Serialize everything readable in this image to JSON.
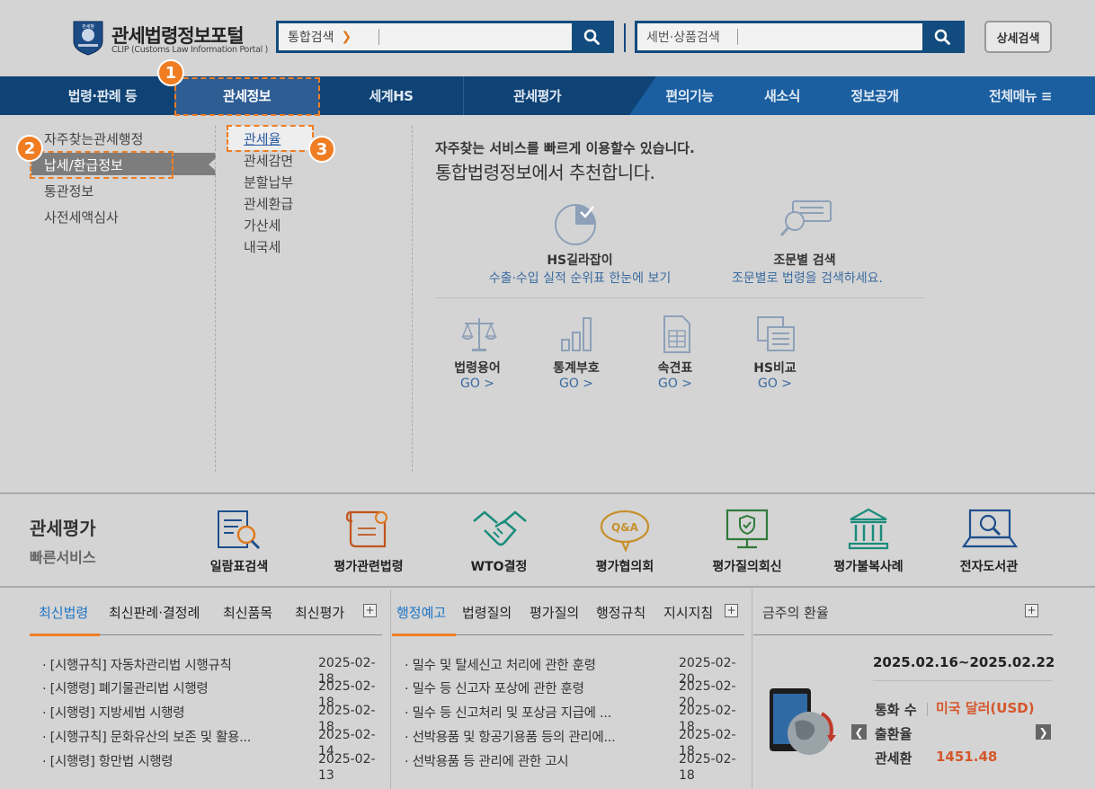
{
  "header": {
    "logo_title": "관세법령정보포털",
    "logo_subtitle": "CLIP (Customs Law Information Portal )",
    "emblem_text": "관세청",
    "search": {
      "category": "통합검색",
      "placeholder": ""
    },
    "hs_search": {
      "placeholder": "세번·상품검색"
    },
    "advanced_label": "상세검색"
  },
  "nav": {
    "items": [
      "법령·판례 등",
      "관세정보",
      "세계HS",
      "관세평가",
      "편의기능",
      "새소식",
      "정보공개"
    ],
    "all_menu": "전체메뉴 ≡"
  },
  "badges": [
    "1",
    "2",
    "3"
  ],
  "mega_menu": {
    "left": [
      "자주찾는관세행정",
      "납세/환급정보",
      "통관정보",
      "사전세액심사"
    ],
    "sub": [
      "관세율",
      "관세감면",
      "분할납부",
      "관세환급",
      "가산세",
      "내국세"
    ],
    "recommend_line1": "자주찾는 서비스를 빠르게 이용할수 있습니다.",
    "recommend_line2": "통합법령정보에서 추천합니다.",
    "services": [
      {
        "title": "HS길라잡이",
        "desc": "수출·수입 실적 순위표 한눈에 보기"
      },
      {
        "title": "조문별 검색",
        "desc": "조문별로 법령을 검색하세요."
      }
    ],
    "tools": [
      {
        "title": "법령용어",
        "go": "GO >"
      },
      {
        "title": "통계부호",
        "go": "GO >"
      },
      {
        "title": "속견표",
        "go": "GO >"
      },
      {
        "title": "HS비교",
        "go": "GO >"
      }
    ]
  },
  "quick": {
    "title": "관세평가",
    "subtitle": "빠른서비스",
    "items": [
      "일람표검색",
      "평가관련법령",
      "WTO결정",
      "평가협의회",
      "평가질의회신",
      "평가불복사례",
      "전자도서관"
    ]
  },
  "panel1": {
    "tabs": [
      "최신법령",
      "최신판례·결정례",
      "최신품목",
      "최신평가"
    ],
    "rows": [
      {
        "title": "· [시행규칙] 자동차관리법 시행규칙",
        "date": "2025-02-18"
      },
      {
        "title": "· [시행령] 폐기물관리법 시행령",
        "date": "2025-02-18"
      },
      {
        "title": "· [시행령] 지방세법 시행령",
        "date": "2025-02-18"
      },
      {
        "title": "· [시행규칙] 문화유산의 보존 및 활용...",
        "date": "2025-02-14"
      },
      {
        "title": "· [시행령] 항만법 시행령",
        "date": "2025-02-13"
      }
    ]
  },
  "panel2": {
    "tabs": [
      "행정예고",
      "법령질의",
      "평가질의",
      "행정규칙",
      "지시지침"
    ],
    "rows": [
      {
        "title": "· 밀수 및 탈세신고 처리에 관한 훈령",
        "date": "2025-02-20"
      },
      {
        "title": "· 밀수 등 신고자 포상에 관한 훈령",
        "date": "2025-02-20"
      },
      {
        "title": "· 밀수 등 신고처리 및 포상금 지급에 ...",
        "date": "2025-02-18"
      },
      {
        "title": "· 선박용품 및 항공기용품 등의 관리에...",
        "date": "2025-02-18"
      },
      {
        "title": "· 선박용품 등 관리에 관한 고시",
        "date": "2025-02-18"
      }
    ]
  },
  "fx": {
    "title": "금주의 환율",
    "range": "2025.02.16~2025.02.22",
    "label": "통화 수출환율 관세환",
    "currency": "미국 달러(USD)",
    "value": "1451.48"
  },
  "colors": {
    "navy": "#0f4375",
    "nav_blue": "#1b5fa1",
    "accent_orange": "#f07d22",
    "link_blue": "#3b6ba0"
  }
}
